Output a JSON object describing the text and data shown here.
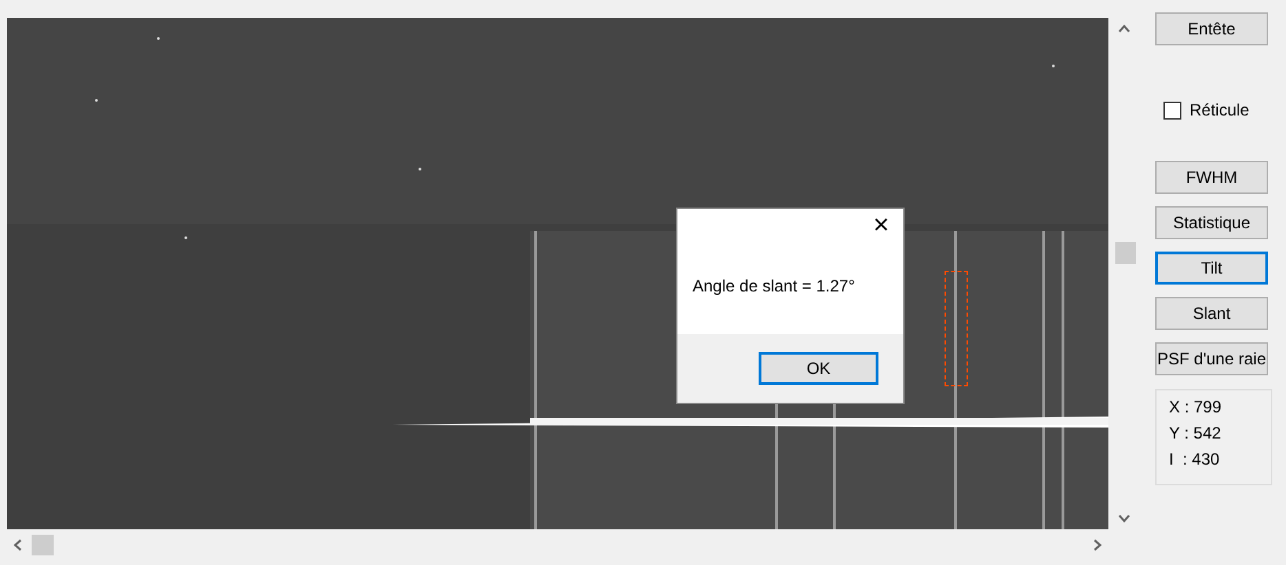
{
  "dialog": {
    "message": "Angle de slant = 1.27°",
    "close_icon": "×",
    "ok_button": {
      "label": "OK",
      "focused": true
    }
  },
  "buttons_top": [
    {
      "label": "Entête",
      "focused": false
    }
  ],
  "reticle": {
    "label": "Réticule",
    "checked": false
  },
  "buttons": [
    {
      "label": "FWHM",
      "focused": false
    },
    {
      "label": "Statistique",
      "focused": false
    },
    {
      "label": "Tilt",
      "focused": true
    },
    {
      "label": "Slant",
      "focused": false
    },
    {
      "label": "PSF d'une raie",
      "focused": false
    }
  ],
  "readout": [
    {
      "label": "X : 799"
    },
    {
      "label": "Y : 542"
    },
    {
      "label": "I  : 430"
    }
  ]
}
